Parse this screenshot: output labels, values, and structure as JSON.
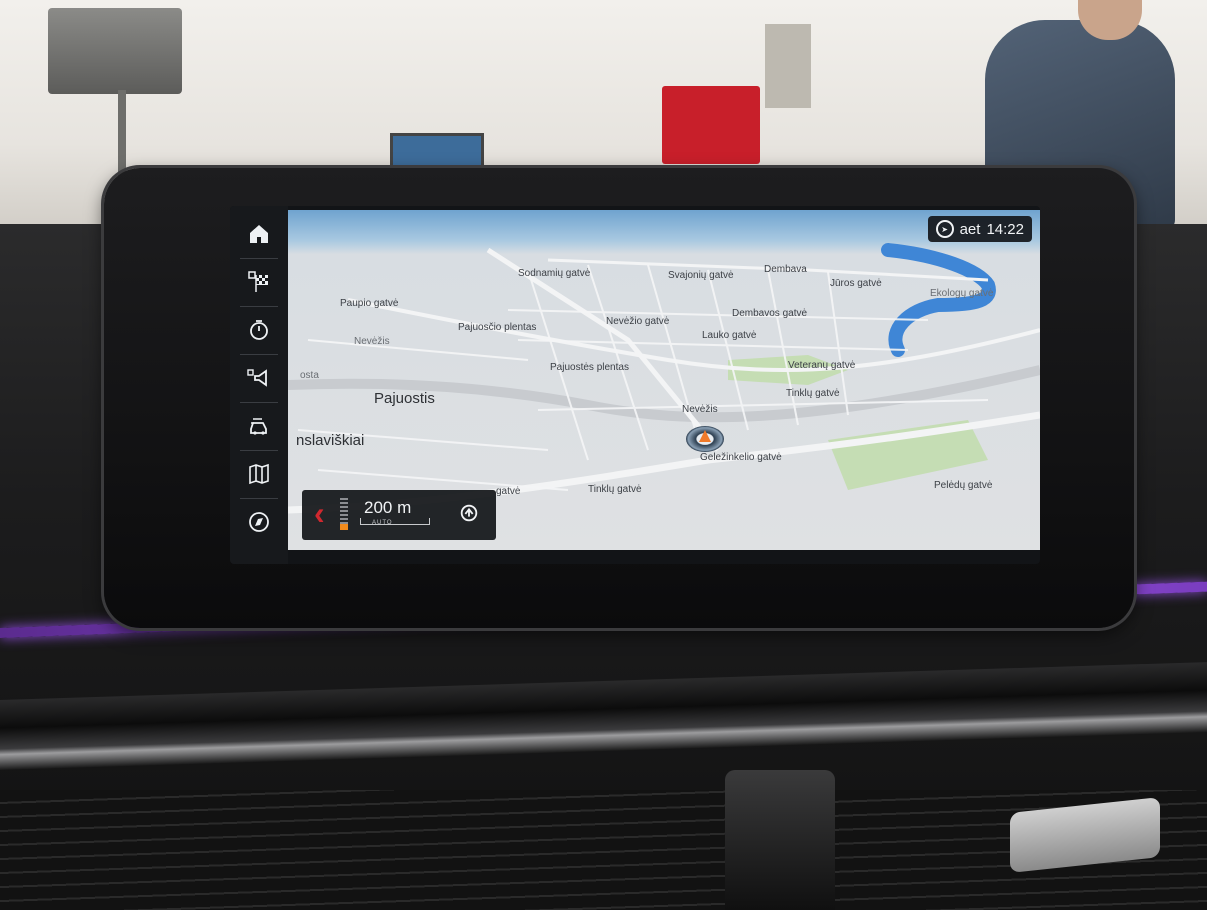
{
  "status": {
    "region": "aet",
    "time": "14:22"
  },
  "sidebar": {
    "items": [
      {
        "icon": "home-icon"
      },
      {
        "icon": "destination-flag-icon"
      },
      {
        "icon": "timer-icon"
      },
      {
        "icon": "speaker-icon"
      },
      {
        "icon": "car-icon"
      },
      {
        "icon": "map-icon"
      },
      {
        "icon": "compass-icon"
      }
    ]
  },
  "guidance": {
    "distance": "200 m",
    "mode": "AUTO"
  },
  "map": {
    "labels": {
      "sodnamiu": "Sodnamių gatvė",
      "svajoniu": "Svajonių gatvė",
      "dembava": "Dembava",
      "juros": "Jūros gatvė",
      "paupio": "Paupio gatvė",
      "dembavos": "Dembavos gatvė",
      "ekologu": "Ekologų gatvė",
      "pajuoscio": "Pajuosčio plentas",
      "nevezio_g": "Nevėžio gatvė",
      "nevezis1": "Nevėžis",
      "lauko": "Lauko gatvė",
      "pajuostes": "Pajuostės plentas",
      "veteranu": "Veteranų gatvė",
      "osta": "osta",
      "pajuostis": "Pajuostis",
      "tinkliu": "Tinklų gatvė",
      "nevezis2": "Nevėžis",
      "vilniaus": "nslaviškiai",
      "gelezinkelio": "Geležinkelio gatvė",
      "gatve_left": "gatvė",
      "tinkliu2": "Tinklų gatvė",
      "pelenu": "Pelėdų gatvė"
    }
  }
}
